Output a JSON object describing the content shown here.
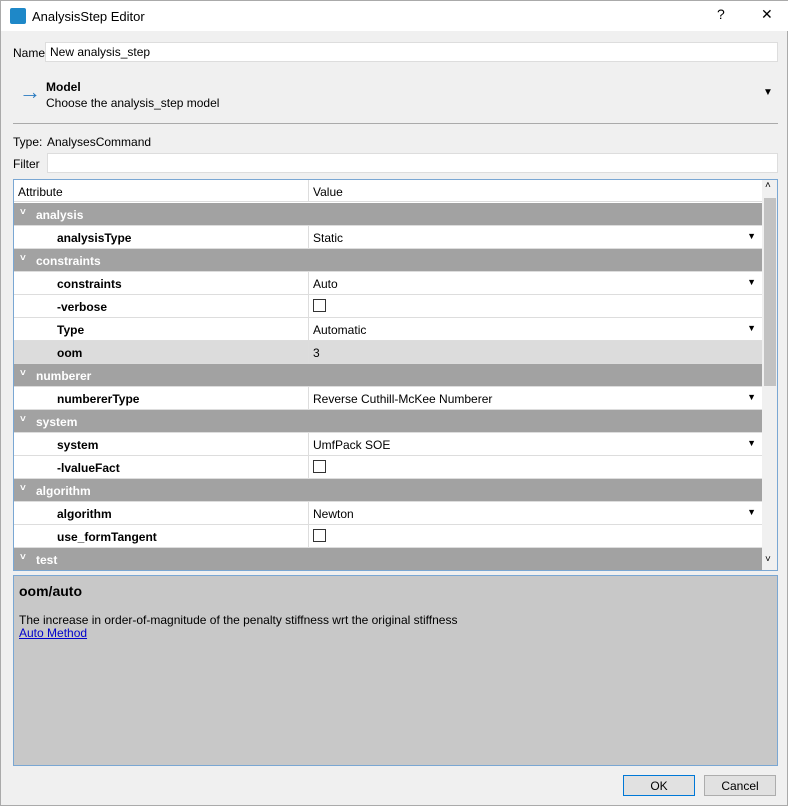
{
  "window": {
    "title": "AnalysisStep Editor",
    "help": "?",
    "close": "✕"
  },
  "name": {
    "label": "Name",
    "value": "New analysis_step"
  },
  "model": {
    "title": "Model",
    "subtitle": "Choose the analysis_step model"
  },
  "type": {
    "label": "Type:",
    "value": "AnalysesCommand"
  },
  "filter": {
    "label": "Filter",
    "value": ""
  },
  "table": {
    "headers": [
      "Attribute",
      "Value"
    ],
    "rows": [
      {
        "kind": "group",
        "name": "analysis"
      },
      {
        "kind": "attr",
        "name": "analysisType",
        "value": "Static",
        "editor": "dropdown"
      },
      {
        "kind": "group",
        "name": "constraints"
      },
      {
        "kind": "attr",
        "name": "constraints",
        "value": "Auto",
        "editor": "dropdown"
      },
      {
        "kind": "attr",
        "name": "-verbose",
        "value": "",
        "editor": "checkbox"
      },
      {
        "kind": "attr",
        "name": "Type",
        "value": "Automatic",
        "editor": "dropdown"
      },
      {
        "kind": "attr",
        "name": "oom",
        "value": "3",
        "editor": "text",
        "selected": true
      },
      {
        "kind": "group",
        "name": "numberer"
      },
      {
        "kind": "attr",
        "name": "numbererType",
        "value": "Reverse Cuthill-McKee Numberer",
        "editor": "dropdown"
      },
      {
        "kind": "group",
        "name": "system"
      },
      {
        "kind": "attr",
        "name": "system",
        "value": "UmfPack SOE",
        "editor": "dropdown"
      },
      {
        "kind": "attr",
        "name": "-lvalueFact",
        "value": "",
        "editor": "checkbox"
      },
      {
        "kind": "group",
        "name": "algorithm"
      },
      {
        "kind": "attr",
        "name": "algorithm",
        "value": "Newton",
        "editor": "dropdown"
      },
      {
        "kind": "attr",
        "name": "use_formTangent",
        "value": "",
        "editor": "checkbox"
      },
      {
        "kind": "group",
        "name": "test"
      }
    ]
  },
  "description": {
    "title": "oom/auto",
    "text": "The increase in order-of-magnitude of the penalty stiffness wrt the original stiffness",
    "link": "Auto Method"
  },
  "buttons": {
    "ok": "OK",
    "cancel": "Cancel"
  }
}
